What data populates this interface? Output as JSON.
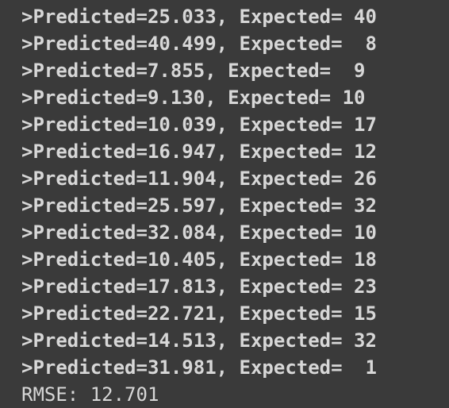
{
  "terminal": {
    "lines": [
      ">Predicted=25.033, Expected= 40",
      ">Predicted=40.499, Expected=  8",
      ">Predicted=7.855, Expected=  9",
      ">Predicted=9.130, Expected= 10",
      ">Predicted=10.039, Expected= 17",
      ">Predicted=16.947, Expected= 12",
      ">Predicted=11.904, Expected= 26",
      ">Predicted=25.597, Expected= 32",
      ">Predicted=32.084, Expected= 10",
      ">Predicted=10.405, Expected= 18",
      ">Predicted=17.813, Expected= 23",
      ">Predicted=22.721, Expected= 15",
      ">Predicted=14.513, Expected= 32",
      ">Predicted=31.981, Expected=  1"
    ],
    "rmse_line": "RMSE: 12.701"
  },
  "colors": {
    "background": "#3a3a3a",
    "text": "#d7d7d7"
  }
}
